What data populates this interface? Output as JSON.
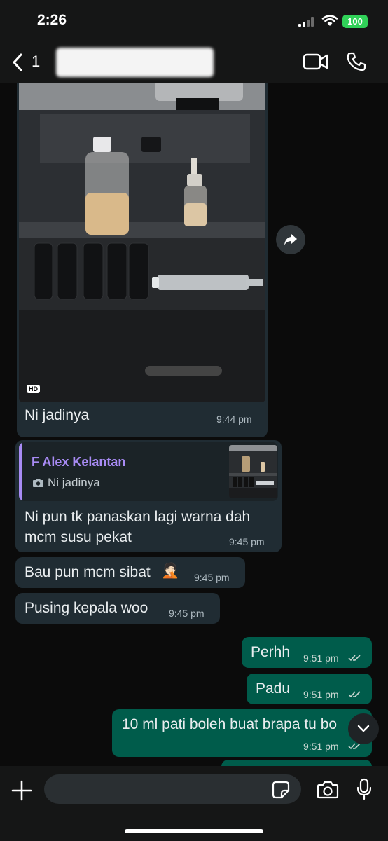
{
  "status": {
    "time": "2:26",
    "battery": "100"
  },
  "header": {
    "back_count": "1"
  },
  "messages": [
    {
      "text": "Ni jadinya",
      "time": "9:44 pm"
    },
    {
      "reply_to_name": "F Alex Kelantan",
      "reply_to_text": "Ni jadinya",
      "line1": "Ni pun tk panaskan lagi warna dah",
      "line2": "mcm susu pekat",
      "time": "9:45 pm"
    },
    {
      "text": "Bau pun mcm sibat",
      "emoji": "🤦🏻",
      "time": "9:45 pm"
    },
    {
      "text": "Pusing kepala woo",
      "time": "9:45 pm"
    }
  ],
  "outgoing": [
    {
      "text": "Perhh",
      "time": "9:51 pm"
    },
    {
      "text": "Padu",
      "time": "9:51 pm"
    },
    {
      "text": "10 ml pati boleh buat brapa tu bo",
      "time": "9:51 pm"
    }
  ],
  "photo": {
    "badge": "HD"
  },
  "icons": {
    "back": "chevron-left-icon",
    "video": "video-call-icon",
    "phone": "phone-call-icon",
    "forward": "forward-icon",
    "plus": "plus-icon",
    "sticker": "sticker-icon",
    "camera": "camera-icon",
    "mic": "microphone-icon",
    "scroll": "chevron-down-icon"
  },
  "colors": {
    "incoming_bubble": "#202c33",
    "outgoing_bubble": "#005c4b",
    "quote_name": "#a88bf4",
    "background": "#0b0b0b"
  }
}
